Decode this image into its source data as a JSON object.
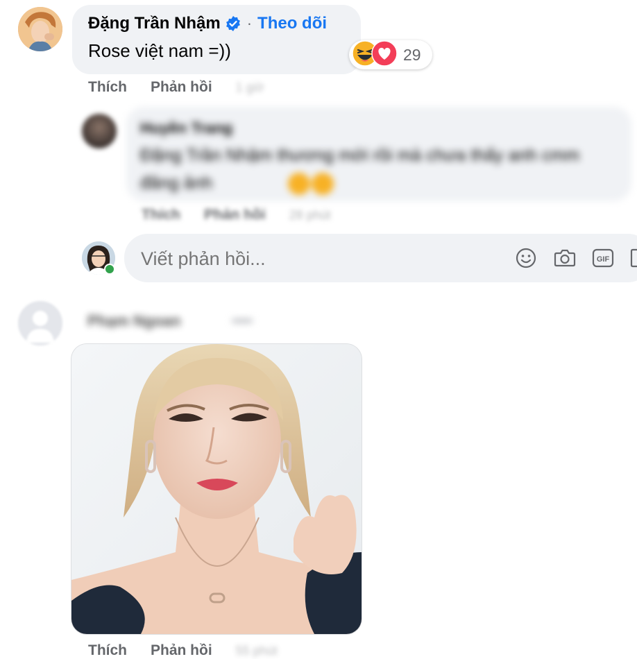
{
  "comment1": {
    "author": "Đặng Trần Nhậm",
    "verified": true,
    "separator": "·",
    "follow_label": "Theo dõi",
    "text": "Rose việt nam =))",
    "reaction_count": "29",
    "reaction_icons": [
      "haha-icon",
      "love-icon"
    ],
    "like_label": "Thích",
    "reply_label": "Phản hồi",
    "time": "1 giờ"
  },
  "reply1": {
    "author": "Huyền Trang",
    "text": "Đặng Trần Nhậm thương mới rồi mà chưa thấy anh cmm đăng ảnh",
    "like_label": "Thích",
    "reply_label": "Phản hồi",
    "time": "28 phút"
  },
  "reply_input": {
    "placeholder": "Viết phản hồi...",
    "icons": [
      "emoji-icon",
      "camera-icon",
      "gif-icon",
      "sticker-icon"
    ]
  },
  "comment2": {
    "author": "Phạm Ngoan",
    "like_label": "Thích",
    "reply_label": "Phản hồi",
    "time": "55 phút"
  },
  "colors": {
    "accent": "#1877f2",
    "bubble": "#f0f2f5",
    "secondary_text": "#65676b",
    "online": "#31a24c"
  }
}
